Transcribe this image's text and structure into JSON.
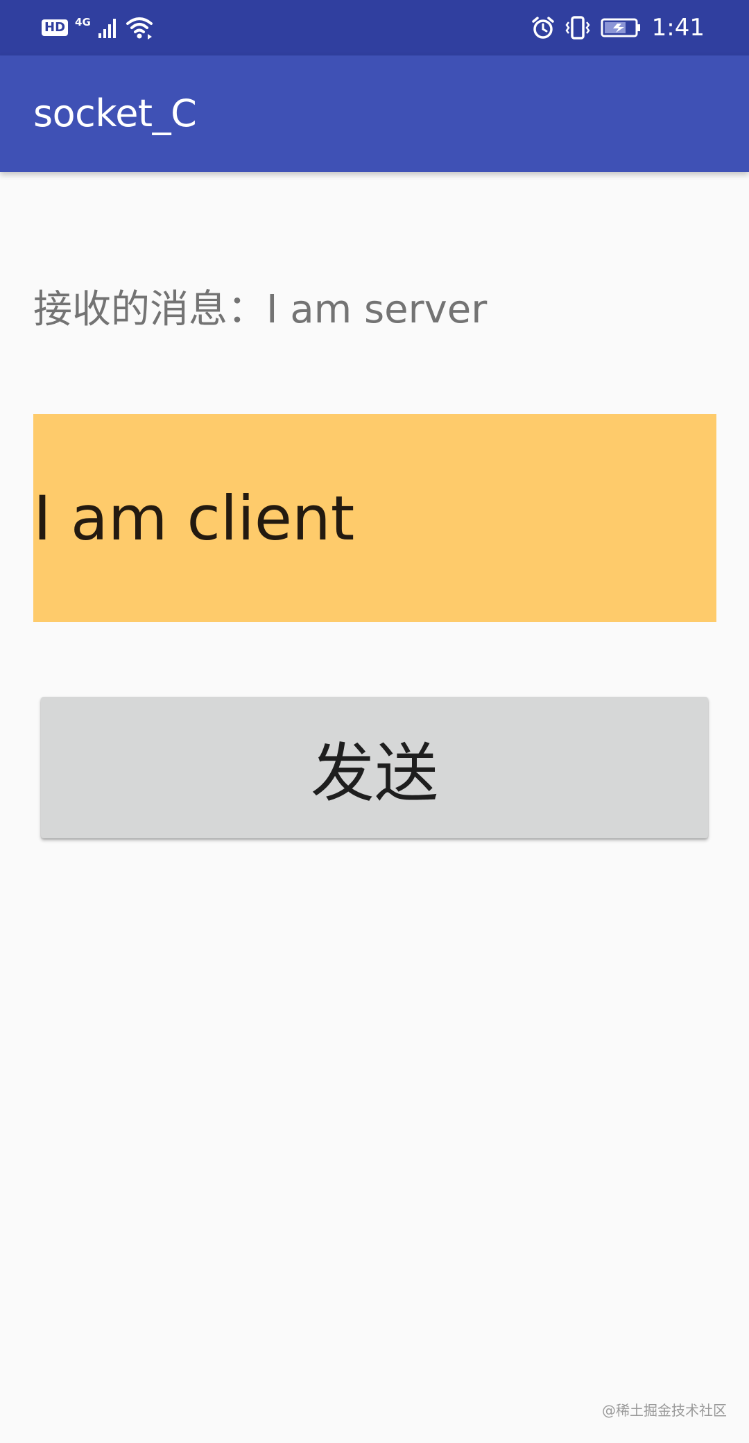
{
  "status_bar": {
    "hd_label": "HD",
    "network_type": "4G",
    "time": "1:41",
    "icons": [
      "hd-icon",
      "signal-icon",
      "wifi-icon",
      "alarm-icon",
      "vibrate-icon",
      "battery-charging-icon"
    ]
  },
  "app_bar": {
    "title": "socket_C"
  },
  "main": {
    "received_message": "接收的消息：I am server",
    "input_value": "I am client",
    "send_button_label": "发送"
  },
  "watermark": "@稀土掘金技术社区",
  "colors": {
    "status_bar": "#303f9f",
    "app_bar": "#3f51b5",
    "input_background": "#fecb6b",
    "button_background": "#d6d7d7",
    "page_background": "#fafafa"
  }
}
